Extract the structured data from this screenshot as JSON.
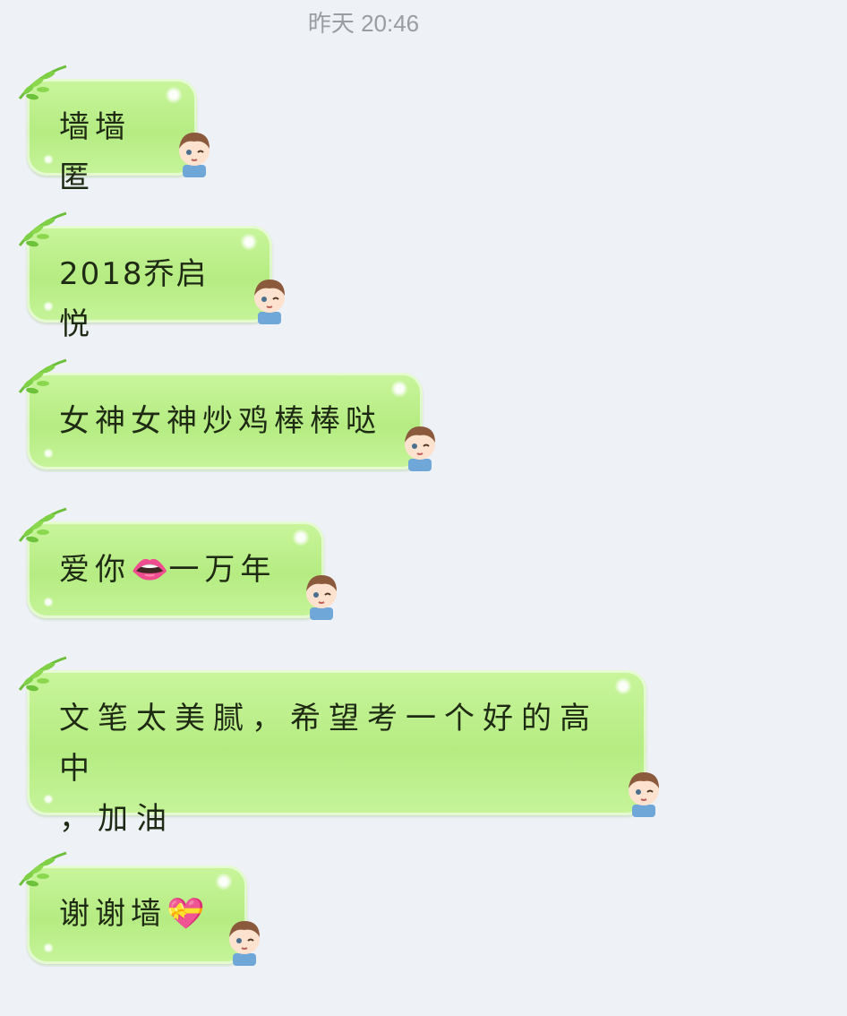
{
  "chat": {
    "timestamp": "昨天 20:46",
    "messages": [
      {
        "text": "墙墙匿"
      },
      {
        "text": "2018乔启悦"
      },
      {
        "text": "女神女神炒鸡棒棒哒"
      },
      {
        "text": "爱你"
      },
      {
        "text": "一万年"
      },
      {
        "text": "文笔太美腻，希望考一个好的高中\n，加油"
      },
      {
        "text": "谢谢墙"
      }
    ],
    "emojis": {
      "lips": "👄",
      "heart_ribbon": "💝"
    }
  }
}
